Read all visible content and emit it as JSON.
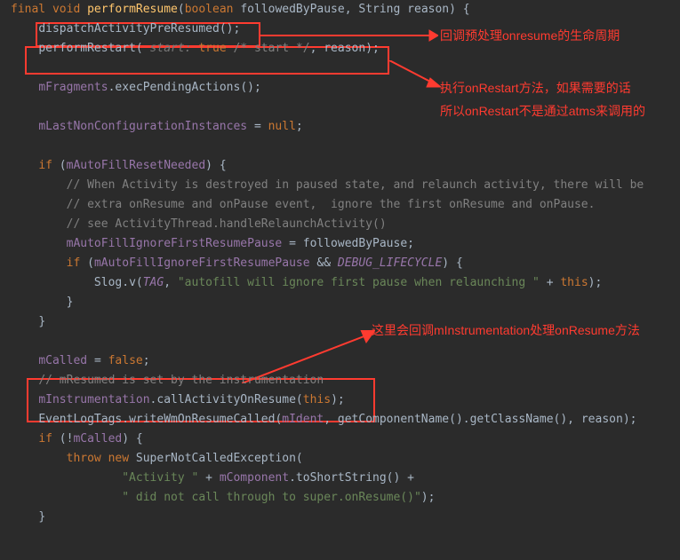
{
  "code": {
    "l1": {
      "kw1": "final",
      "kw2": "void",
      "name": "performResume",
      "p1t": "boolean",
      "p1n": "followedByPause",
      "p2t": "String",
      "p2n": "reason"
    },
    "l2": {
      "call": "dispatchActivityPreResumed"
    },
    "l3": {
      "call": "performRestart",
      "hint": "start:",
      "val": "true",
      "cmt": "/* start */",
      "arg": "reason"
    },
    "l5": {
      "obj": "mFragments",
      "m": "execPendingActions"
    },
    "l7": {
      "obj": "mLastNonConfigurationInstances",
      "val": "null"
    },
    "l9": {
      "kw": "if",
      "cond": "mAutoFillResetNeeded"
    },
    "l10": {
      "c": "// When Activity is destroyed in paused state, and relaunch activity, there will be"
    },
    "l11": {
      "c": "// extra onResume and onPause event,  ignore the first onResume and onPause."
    },
    "l12": {
      "c": "// see ActivityThread.handleRelaunchActivity()"
    },
    "l13": {
      "lhs": "mAutoFillIgnoreFirstResumePause",
      "rhs": "followedByPause"
    },
    "l14": {
      "kw": "if",
      "c1": "mAutoFillIgnoreFirstResumePause",
      "c2": "DEBUG_LIFECYCLE"
    },
    "l15": {
      "cls": "Slog",
      "m": "v",
      "a1": "TAG",
      "s": "\"autofill will ignore first pause when relaunching \"",
      "a2": "this"
    },
    "l19": {
      "lhs": "mCalled",
      "rhs": "false"
    },
    "l20": {
      "c": "// mResumed is set by the instrumentation"
    },
    "l21": {
      "obj": "mInstrumentation",
      "m": "callActivityOnResume",
      "a": "this"
    },
    "l22": {
      "cls": "EventLogTags",
      "m": "writeWmOnResumeCalled",
      "a1": "mIdent",
      "a2": "getComponentName",
      "a3": "getClassName",
      "a4": "reason"
    },
    "l23": {
      "kw": "if",
      "cond": "mCalled"
    },
    "l24": {
      "kw1": "throw",
      "kw2": "new",
      "exc": "SuperNotCalledException"
    },
    "l25": {
      "s": "\"Activity \"",
      "obj": "mComponent",
      "m": "toShortString"
    },
    "l26": {
      "s": "\" did not call through to super.onResume()\""
    }
  },
  "annot": {
    "a1": "回调预处理onresume的生命周期",
    "a2": "执行onRestart方法，如果需要的话",
    "a3": "所以onRestart不是通过atms来调用的",
    "a4": "这里会回调mInstrumentation处理onResume方法"
  }
}
